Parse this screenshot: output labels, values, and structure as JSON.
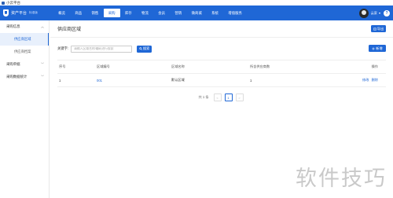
{
  "window": {
    "title": "小云平台"
  },
  "brand": {
    "name": "资产平台",
    "version": "标准版"
  },
  "nav": {
    "items": [
      {
        "label": "概览",
        "active": false
      },
      {
        "label": "商品",
        "active": false
      },
      {
        "label": "销售",
        "active": false
      },
      {
        "label": "采购",
        "active": true
      },
      {
        "label": "库存",
        "active": false
      },
      {
        "label": "物流",
        "active": false
      },
      {
        "label": "会员",
        "active": false
      },
      {
        "label": "营销",
        "active": false
      },
      {
        "label": "微商城",
        "active": false
      },
      {
        "label": "系统",
        "active": false
      },
      {
        "label": "增值服务",
        "active": false
      }
    ]
  },
  "user": {
    "name": "云家",
    "caret": "▾",
    "help": "?"
  },
  "sidebar": {
    "groups": [
      {
        "label": "采购信息",
        "chevron": "︿",
        "items": [
          {
            "label": "供应商区域",
            "active": true
          },
          {
            "label": "供应商档案",
            "active": false
          }
        ]
      },
      {
        "label": "采购单据",
        "chevron": "﹀",
        "items": []
      },
      {
        "label": "采购数据统计",
        "chevron": "﹀",
        "items": []
      }
    ]
  },
  "page": {
    "title": "供应商区域",
    "export_label": "导出",
    "search_label": "关键字:",
    "search_placeholder": "请输入区域名称/编码进行搜索",
    "search_button": "搜索",
    "add_button": "新增"
  },
  "table": {
    "headers": [
      "序号",
      "区域编号",
      "区域名称",
      "所含供应商数",
      "操作"
    ],
    "rows": [
      {
        "index": "1",
        "code": "001",
        "name": "默认区域",
        "count": "1",
        "edit": "修改",
        "delete": "删除"
      }
    ]
  },
  "pagination": {
    "total": "共 1 条",
    "prev": "<",
    "current": "1",
    "next": ">"
  },
  "watermark": "软件技巧",
  "colors": {
    "primary": "#1f67d6",
    "active_bg": "#e8f0fc"
  }
}
